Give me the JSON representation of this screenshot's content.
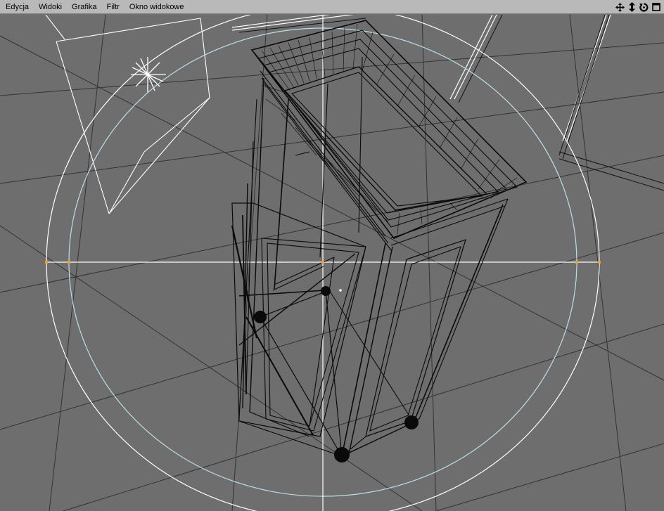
{
  "menu": {
    "items": [
      "Edycja",
      "Widoki",
      "Grafika",
      "Filtr",
      "Okno widokowe"
    ]
  },
  "nav_icons": [
    {
      "name": "move-view-icon",
      "glyph": "move"
    },
    {
      "name": "zoom-view-icon",
      "glyph": "dolly"
    },
    {
      "name": "rotate-view-icon",
      "glyph": "rotate"
    },
    {
      "name": "maximize-view-icon",
      "glyph": "maximize"
    }
  ],
  "colors": {
    "menubar": "#b9b9b9",
    "viewport_bg": "#6e6e6e",
    "grid": "#333333",
    "wireframe": "#0a0a0a",
    "axis": "#ffffff",
    "gizmo_ring": "#bcdfe8",
    "gizmo_handle": "#f0a020"
  }
}
